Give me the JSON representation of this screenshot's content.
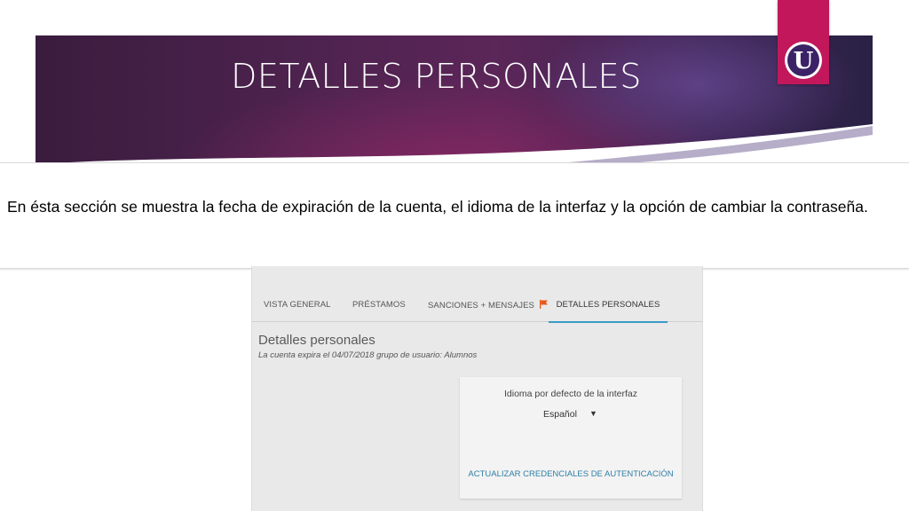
{
  "slide": {
    "title": "DETALLES PERSONALES",
    "logo_letter": "U",
    "caption": "En ésta sección se muestra la fecha de expiración de la cuenta, el idioma de la interfaz y la opción de cambiar la contraseña."
  },
  "account": {
    "tabs": [
      {
        "label": "VISTA GENERAL"
      },
      {
        "label": "PRÉSTAMOS"
      },
      {
        "label": "SANCIONES + MENSAJES"
      },
      {
        "label": "DETALLES PERSONALES"
      }
    ],
    "active_tab": "DETALLES PERSONALES",
    "section_title": "Detalles personales",
    "section_subtitle": "La cuenta expira el 04/07/2018 grupo de usuario: Alumnos",
    "language_label": "Idioma por defecto de la interfaz",
    "language_value": "Español",
    "credentials_link": "ACTUALIZAR CREDENCIALES DE AUTENTICACIÓN"
  },
  "colors": {
    "accent_tab": "#3a9bc8",
    "logo_bg": "#c2185b",
    "flag": "#e8571b",
    "link": "#2f7fa6"
  },
  "icons": {
    "flag": "flag-icon",
    "caret": "caret-down-icon",
    "logo": "u-logo-icon"
  }
}
